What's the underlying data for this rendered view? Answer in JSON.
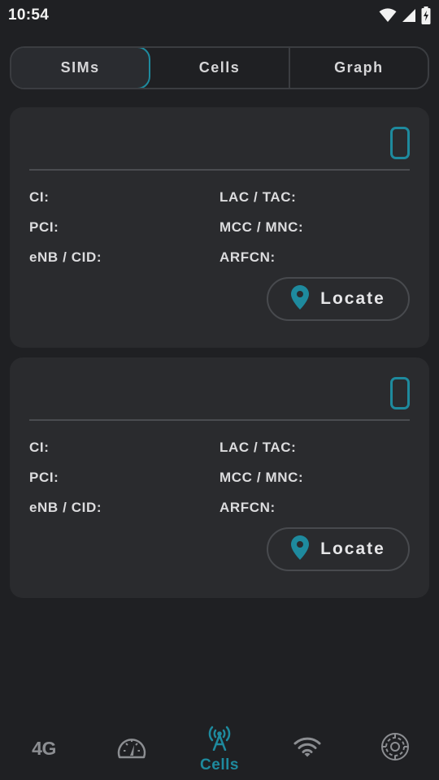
{
  "status_bar": {
    "time": "10:54",
    "icons": [
      "wifi-icon",
      "signal-icon",
      "battery-charging-icon"
    ]
  },
  "tabs": [
    {
      "label": "SIMs",
      "active": true
    },
    {
      "label": "Cells",
      "active": false
    },
    {
      "label": "Graph",
      "active": false
    }
  ],
  "cards": [
    {
      "fields": {
        "ci": "CI:",
        "pci": "PCI:",
        "enb_cid": "eNB / CID:",
        "lac_tac": "LAC / TAC:",
        "mcc_mnc": "MCC / MNC:",
        "arfcn": "ARFCN:"
      },
      "locate_label": "Locate"
    },
    {
      "fields": {
        "ci": "CI:",
        "pci": "PCI:",
        "enb_cid": "eNB / CID:",
        "lac_tac": "LAC / TAC:",
        "mcc_mnc": "MCC / MNC:",
        "arfcn": "ARFCN:"
      },
      "locate_label": "Locate"
    }
  ],
  "bottom_nav": {
    "items": [
      {
        "icon": "4g-text",
        "text": "4G"
      },
      {
        "icon": "speedometer-icon"
      },
      {
        "icon": "cell-tower-icon",
        "label": "Cells",
        "active": true
      },
      {
        "icon": "wifi-icon"
      },
      {
        "icon": "settings-gear-icon"
      }
    ]
  },
  "colors": {
    "background": "#1f2023",
    "card": "#2a2b2e",
    "accent": "#1e8a9e",
    "text": "#dcdcde",
    "inactive_icon": "#8c8e92"
  }
}
